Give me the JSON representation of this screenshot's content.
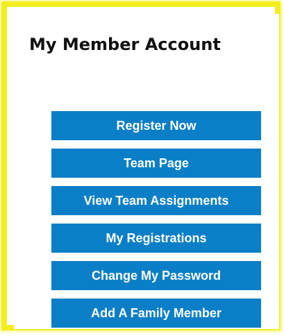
{
  "panel": {
    "title": "My Member Account"
  },
  "buttons": {
    "register": "Register Now",
    "team_page": "Team Page",
    "view_team_assignments": "View Team Assignments",
    "my_registrations": "My Registrations",
    "change_password": "Change My Password",
    "add_family_member": "Add A Family Member"
  },
  "colors": {
    "border_highlight": "#f2ee1f",
    "button_background": "#0a7fc7",
    "button_text": "#ffffff",
    "title_text": "#111111"
  }
}
